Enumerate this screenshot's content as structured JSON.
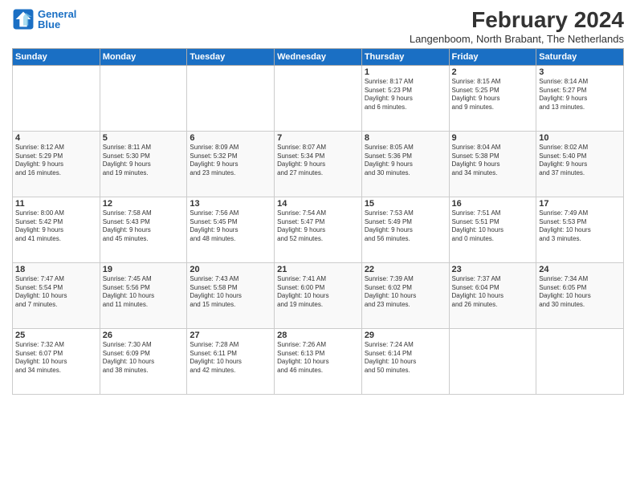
{
  "header": {
    "logo_line1": "General",
    "logo_line2": "Blue",
    "main_title": "February 2024",
    "subtitle": "Langenboom, North Brabant, The Netherlands"
  },
  "days_of_week": [
    "Sunday",
    "Monday",
    "Tuesday",
    "Wednesday",
    "Thursday",
    "Friday",
    "Saturday"
  ],
  "weeks": [
    [
      {
        "day": "",
        "text": ""
      },
      {
        "day": "",
        "text": ""
      },
      {
        "day": "",
        "text": ""
      },
      {
        "day": "",
        "text": ""
      },
      {
        "day": "1",
        "text": "Sunrise: 8:17 AM\nSunset: 5:23 PM\nDaylight: 9 hours\nand 6 minutes."
      },
      {
        "day": "2",
        "text": "Sunrise: 8:15 AM\nSunset: 5:25 PM\nDaylight: 9 hours\nand 9 minutes."
      },
      {
        "day": "3",
        "text": "Sunrise: 8:14 AM\nSunset: 5:27 PM\nDaylight: 9 hours\nand 13 minutes."
      }
    ],
    [
      {
        "day": "4",
        "text": "Sunrise: 8:12 AM\nSunset: 5:29 PM\nDaylight: 9 hours\nand 16 minutes."
      },
      {
        "day": "5",
        "text": "Sunrise: 8:11 AM\nSunset: 5:30 PM\nDaylight: 9 hours\nand 19 minutes."
      },
      {
        "day": "6",
        "text": "Sunrise: 8:09 AM\nSunset: 5:32 PM\nDaylight: 9 hours\nand 23 minutes."
      },
      {
        "day": "7",
        "text": "Sunrise: 8:07 AM\nSunset: 5:34 PM\nDaylight: 9 hours\nand 27 minutes."
      },
      {
        "day": "8",
        "text": "Sunrise: 8:05 AM\nSunset: 5:36 PM\nDaylight: 9 hours\nand 30 minutes."
      },
      {
        "day": "9",
        "text": "Sunrise: 8:04 AM\nSunset: 5:38 PM\nDaylight: 9 hours\nand 34 minutes."
      },
      {
        "day": "10",
        "text": "Sunrise: 8:02 AM\nSunset: 5:40 PM\nDaylight: 9 hours\nand 37 minutes."
      }
    ],
    [
      {
        "day": "11",
        "text": "Sunrise: 8:00 AM\nSunset: 5:42 PM\nDaylight: 9 hours\nand 41 minutes."
      },
      {
        "day": "12",
        "text": "Sunrise: 7:58 AM\nSunset: 5:43 PM\nDaylight: 9 hours\nand 45 minutes."
      },
      {
        "day": "13",
        "text": "Sunrise: 7:56 AM\nSunset: 5:45 PM\nDaylight: 9 hours\nand 48 minutes."
      },
      {
        "day": "14",
        "text": "Sunrise: 7:54 AM\nSunset: 5:47 PM\nDaylight: 9 hours\nand 52 minutes."
      },
      {
        "day": "15",
        "text": "Sunrise: 7:53 AM\nSunset: 5:49 PM\nDaylight: 9 hours\nand 56 minutes."
      },
      {
        "day": "16",
        "text": "Sunrise: 7:51 AM\nSunset: 5:51 PM\nDaylight: 10 hours\nand 0 minutes."
      },
      {
        "day": "17",
        "text": "Sunrise: 7:49 AM\nSunset: 5:53 PM\nDaylight: 10 hours\nand 3 minutes."
      }
    ],
    [
      {
        "day": "18",
        "text": "Sunrise: 7:47 AM\nSunset: 5:54 PM\nDaylight: 10 hours\nand 7 minutes."
      },
      {
        "day": "19",
        "text": "Sunrise: 7:45 AM\nSunset: 5:56 PM\nDaylight: 10 hours\nand 11 minutes."
      },
      {
        "day": "20",
        "text": "Sunrise: 7:43 AM\nSunset: 5:58 PM\nDaylight: 10 hours\nand 15 minutes."
      },
      {
        "day": "21",
        "text": "Sunrise: 7:41 AM\nSunset: 6:00 PM\nDaylight: 10 hours\nand 19 minutes."
      },
      {
        "day": "22",
        "text": "Sunrise: 7:39 AM\nSunset: 6:02 PM\nDaylight: 10 hours\nand 23 minutes."
      },
      {
        "day": "23",
        "text": "Sunrise: 7:37 AM\nSunset: 6:04 PM\nDaylight: 10 hours\nand 26 minutes."
      },
      {
        "day": "24",
        "text": "Sunrise: 7:34 AM\nSunset: 6:05 PM\nDaylight: 10 hours\nand 30 minutes."
      }
    ],
    [
      {
        "day": "25",
        "text": "Sunrise: 7:32 AM\nSunset: 6:07 PM\nDaylight: 10 hours\nand 34 minutes."
      },
      {
        "day": "26",
        "text": "Sunrise: 7:30 AM\nSunset: 6:09 PM\nDaylight: 10 hours\nand 38 minutes."
      },
      {
        "day": "27",
        "text": "Sunrise: 7:28 AM\nSunset: 6:11 PM\nDaylight: 10 hours\nand 42 minutes."
      },
      {
        "day": "28",
        "text": "Sunrise: 7:26 AM\nSunset: 6:13 PM\nDaylight: 10 hours\nand 46 minutes."
      },
      {
        "day": "29",
        "text": "Sunrise: 7:24 AM\nSunset: 6:14 PM\nDaylight: 10 hours\nand 50 minutes."
      },
      {
        "day": "",
        "text": ""
      },
      {
        "day": "",
        "text": ""
      }
    ]
  ]
}
